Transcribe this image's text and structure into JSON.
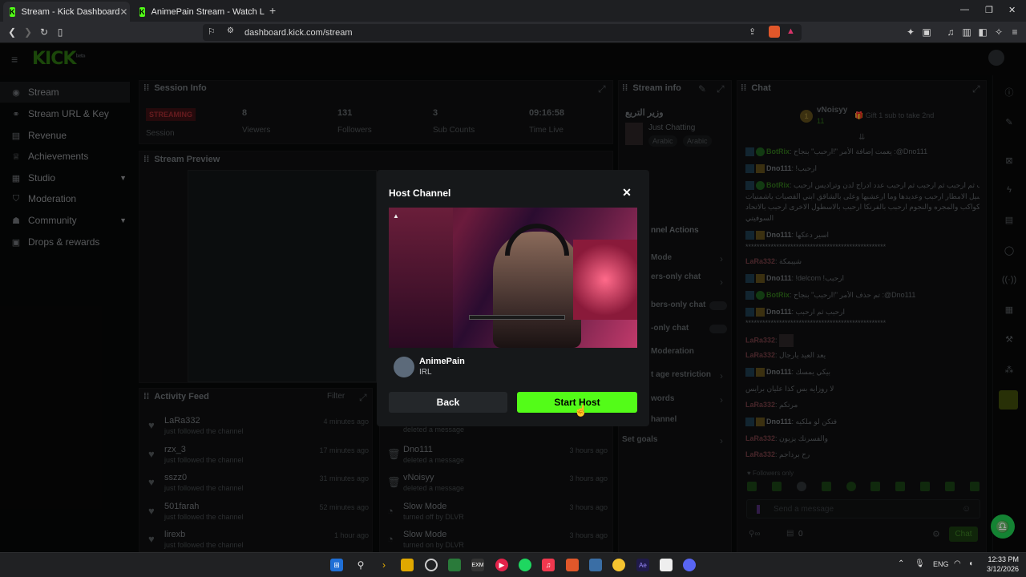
{
  "browser": {
    "tabs": [
      {
        "title": "Stream - Kick Dashboard",
        "active": true
      },
      {
        "title": "AnimePain Stream - Watch Live on Ki",
        "active": false
      }
    ],
    "new_tab": "+",
    "url": "dashboard.kick.com/stream",
    "window_controls": [
      "—",
      "❐",
      "✕"
    ]
  },
  "dashboard": {
    "logo": "KICK",
    "logo_sup": "beta",
    "sidebar": [
      {
        "label": "Stream",
        "icon": "stream-icon",
        "active": true
      },
      {
        "label": "Stream URL & Key",
        "icon": "link-icon"
      },
      {
        "label": "Revenue",
        "icon": "revenue-icon"
      },
      {
        "label": "Achievements",
        "icon": "trophy-icon"
      },
      {
        "label": "Studio",
        "icon": "studio-icon",
        "expandable": true
      },
      {
        "label": "Moderation",
        "icon": "shield-icon"
      },
      {
        "label": "Community",
        "icon": "community-icon",
        "expandable": true
      },
      {
        "label": "Drops & rewards",
        "icon": "gift-icon"
      }
    ],
    "session": {
      "title": "Session Info",
      "status": "STREAMING",
      "status_label": "Session",
      "stats": [
        {
          "value": "8",
          "label": "Viewers"
        },
        {
          "value": "131",
          "label": "Followers"
        },
        {
          "value": "3",
          "label": "Sub Counts"
        },
        {
          "value": "09:16:58",
          "label": "Time Live"
        }
      ]
    },
    "preview_title": "Stream Preview",
    "activity": {
      "title": "Activity Feed",
      "filter": "Filter",
      "items": [
        {
          "name": "LaRa332",
          "sub": "just followed the channel",
          "time": "4 minutes ago"
        },
        {
          "name": "rzx_3",
          "sub": "just followed the channel",
          "time": "17 minutes ago"
        },
        {
          "name": "sszz0",
          "sub": "just followed the channel",
          "time": "31 minutes ago"
        },
        {
          "name": "501farah",
          "sub": "just followed the channel",
          "time": "52 minutes ago"
        },
        {
          "name": "lirexb",
          "sub": "just followed the channel",
          "time": "1 hour ago"
        }
      ]
    },
    "modlog": {
      "items": [
        {
          "name": "",
          "sub": "deleted a message",
          "time": ""
        },
        {
          "name": "Dno111",
          "sub": "deleted a message",
          "time": "3 hours ago"
        },
        {
          "name": "vNoisyy",
          "sub": "deleted a message",
          "time": "3 hours ago"
        },
        {
          "name": "Slow Mode",
          "sub": "turned off by DLVR",
          "time": "3 hours ago"
        },
        {
          "name": "Slow Mode",
          "sub": "turned on by DLVR",
          "time": "3 hours ago"
        }
      ]
    },
    "stream_info": {
      "title": "Stream info",
      "stream_title": "وزير التريع",
      "category": "Just Chatting",
      "tags": [
        "Arabic",
        "Arabic"
      ]
    },
    "channel_actions": {
      "title": "nnel Actions",
      "items": [
        "Mode",
        "ers-only chat",
        "bers-only chat",
        "-only chat",
        "Moderation",
        "t age restriction",
        "words",
        "hannel",
        "Set goals"
      ]
    },
    "chat": {
      "title": "Chat",
      "top_user": "vNoisyy",
      "top_rank": "1",
      "top_count": "11",
      "gift_text": "Gift 1 sub to take 2nd",
      "messages": [
        {
          "user": "BotRix",
          "text": "يعمت إضافة الأمر \"!ارحبب\" بنجاح :@Dno111",
          "color": "g"
        },
        {
          "user": "Dno111",
          "text": "!ارحبب",
          "color": ""
        },
        {
          "user": "BotRix",
          "text": "ارحبب ثم ارحبب ثم ارحبب ثم ارحبب عدد ادراج لدن وتراديس ارحبب",
          "color": "g"
        },
        {
          "user": "",
          "text": "عراديب سيل الامطار ارحبب وعديدها وما ارعشبها وعلى بالشاقق ابني القصيات ياشمنيات :DLVR",
          "color": ""
        },
        {
          "user": "",
          "text": "من الجوار الكول الكواكب والمجره والنجوم ارحبب بالفرنكا ارحبب بالاسطول الاخرى ارحبب بالاتحاد",
          "color": ""
        },
        {
          "user": "",
          "text": "السوفيتي",
          "color": ""
        },
        {
          "user": "Dno111",
          "text": "اسير دعكها",
          "color": ""
        },
        {
          "user": "",
          "text": "**************************************************",
          "color": ""
        },
        {
          "user": "LaRa332",
          "text": "شيبمكة",
          "color": "r"
        },
        {
          "user": "Dno111",
          "text": "!delcom !ارحبب",
          "color": ""
        },
        {
          "user": "BotRix",
          "text": "تم حذف الأمر \"!ارحبب\" بنجاح :@Dno111",
          "color": "g"
        },
        {
          "user": "Dno111",
          "text": "ارحبب ثم ارحبب",
          "color": ""
        },
        {
          "user": "",
          "text": "**************************************************",
          "color": ""
        },
        {
          "user": "LaRa332",
          "text": "",
          "color": "r"
        },
        {
          "user": "LaRa332",
          "text": "يعد العيد يارجال",
          "color": "r"
        },
        {
          "user": "Dno111",
          "text": "بيكي يمسك",
          "color": ""
        },
        {
          "user": "",
          "text": "لا روزايه بس كذا عليان برايس",
          "color": ""
        },
        {
          "user": "LaRa332",
          "text": "مرتكم",
          "color": "r"
        },
        {
          "user": "Dno111",
          "text": "فتكن لو ملكيه",
          "color": ""
        },
        {
          "user": "LaRa332",
          "text": "والفسرنك يزيون",
          "color": "r"
        },
        {
          "user": "LaRa332",
          "text": "رح برداجم",
          "color": "r"
        }
      ],
      "followers_only": "Followers only",
      "input_placeholder": "Send a message",
      "viewer_count": "0",
      "send_button": "Chat"
    }
  },
  "modal": {
    "title": "Host Channel",
    "channel_name": "AnimePain",
    "category": "IRL",
    "back_label": "Back",
    "start_label": "Start Host"
  },
  "taskbar": {
    "lang": "ENG",
    "time": "12:33 PM",
    "date": "3/12/2026"
  }
}
